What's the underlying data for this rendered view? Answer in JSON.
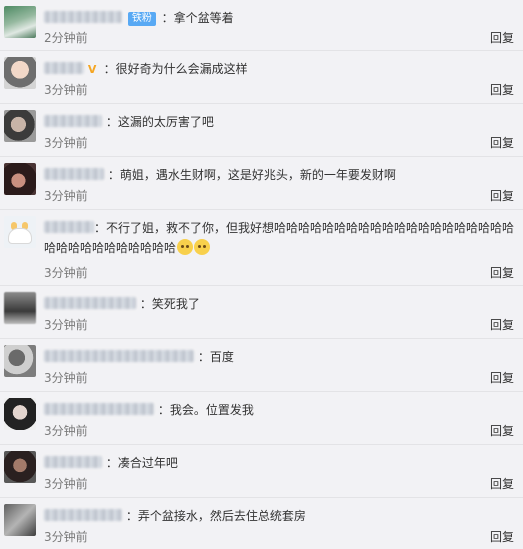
{
  "reply_label": "回复",
  "comments": [
    {
      "badge": "铁粉",
      "vip": "",
      "text": "：拿个盆等着",
      "emoji_count": 0,
      "time": "2分钟前"
    },
    {
      "badge": "",
      "vip": "V",
      "text": "：很好奇为什么会漏成这样",
      "emoji_count": 0,
      "time": "3分钟前"
    },
    {
      "badge": "",
      "vip": "",
      "text": "：这漏的太厉害了吧",
      "emoji_count": 0,
      "time": "3分钟前"
    },
    {
      "badge": "",
      "vip": "",
      "text": "：萌姐，遇水生财啊，这是好兆头，新的一年要发财啊",
      "emoji_count": 0,
      "time": "3分钟前"
    },
    {
      "badge": "",
      "vip": "",
      "text": "：不行了姐，救不了你，但我好想哈哈哈哈哈哈哈哈哈哈哈哈哈哈哈哈哈哈哈哈哈哈哈哈哈哈哈哈哈哈哈",
      "emoji_count": 2,
      "time": "3分钟前"
    },
    {
      "badge": "",
      "vip": "",
      "text": "：笑死我了",
      "emoji_count": 0,
      "time": "3分钟前"
    },
    {
      "badge": "",
      "vip": "",
      "text": "：百度",
      "emoji_count": 0,
      "time": "3分钟前"
    },
    {
      "badge": "",
      "vip": "",
      "text": "：我会。位置发我",
      "emoji_count": 0,
      "time": "3分钟前"
    },
    {
      "badge": "",
      "vip": "",
      "text": "：凑合过年吧",
      "emoji_count": 0,
      "time": "3分钟前"
    },
    {
      "badge": "",
      "vip": "",
      "text": "：弄个盆接水，然后去住总统套房",
      "emoji_count": 0,
      "time": "3分钟前"
    }
  ]
}
